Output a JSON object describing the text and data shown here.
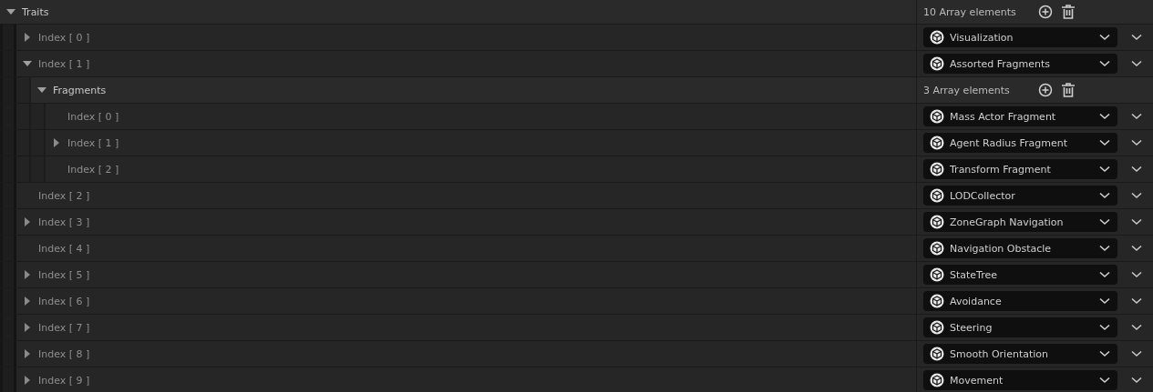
{
  "traits": {
    "kind": "array",
    "label": "Traits",
    "expandable": true,
    "expanded": true,
    "count": "10 Array elements",
    "children": [
      {
        "kind": "element",
        "label": "Index [ 0 ]",
        "expandable": true,
        "expanded": false,
        "value": "Visualization"
      },
      {
        "kind": "element",
        "label": "Index [ 1 ]",
        "expandable": true,
        "expanded": true,
        "value": "Assorted Fragments",
        "children": [
          {
            "kind": "array",
            "label": "Fragments",
            "expandable": true,
            "expanded": true,
            "count": "3 Array elements",
            "children": [
              {
                "kind": "element",
                "label": "Index [ 0 ]",
                "expandable": false,
                "value": "Mass Actor Fragment"
              },
              {
                "kind": "element",
                "label": "Index [ 1 ]",
                "expandable": true,
                "expanded": false,
                "value": "Agent Radius Fragment"
              },
              {
                "kind": "element",
                "label": "Index [ 2 ]",
                "expandable": false,
                "value": "Transform Fragment"
              }
            ]
          }
        ]
      },
      {
        "kind": "element",
        "label": "Index [ 2 ]",
        "expandable": false,
        "value": "LODCollector"
      },
      {
        "kind": "element",
        "label": "Index [ 3 ]",
        "expandable": true,
        "expanded": false,
        "value": "ZoneGraph Navigation"
      },
      {
        "kind": "element",
        "label": "Index [ 4 ]",
        "expandable": false,
        "value": "Navigation Obstacle"
      },
      {
        "kind": "element",
        "label": "Index [ 5 ]",
        "expandable": true,
        "expanded": false,
        "value": "StateTree"
      },
      {
        "kind": "element",
        "label": "Index [ 6 ]",
        "expandable": true,
        "expanded": false,
        "value": "Avoidance"
      },
      {
        "kind": "element",
        "label": "Index [ 7 ]",
        "expandable": true,
        "expanded": false,
        "value": "Steering"
      },
      {
        "kind": "element",
        "label": "Index [ 8 ]",
        "expandable": true,
        "expanded": false,
        "value": "Smooth Orientation"
      },
      {
        "kind": "element",
        "label": "Index [ 9 ]",
        "expandable": true,
        "expanded": false,
        "value": "Movement"
      }
    ]
  }
}
